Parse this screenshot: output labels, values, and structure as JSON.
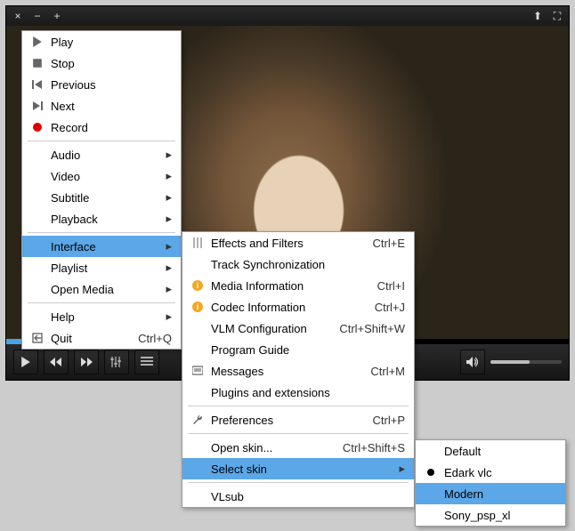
{
  "titlebar": {
    "close": "×",
    "min": "−",
    "plus": "+",
    "up": "⬆",
    "full": "⛶"
  },
  "menu1": {
    "play": "Play",
    "stop": "Stop",
    "previous": "Previous",
    "next": "Next",
    "record": "Record",
    "audio": "Audio",
    "video": "Video",
    "subtitle": "Subtitle",
    "playback": "Playback",
    "interface": "Interface",
    "playlist": "Playlist",
    "open_media": "Open Media",
    "help": "Help",
    "quit": "Quit",
    "quit_sc": "Ctrl+Q"
  },
  "menu2": {
    "effects": "Effects and Filters",
    "effects_sc": "Ctrl+E",
    "track_sync": "Track Synchronization",
    "media_info": "Media Information",
    "media_info_sc": "Ctrl+I",
    "codec_info": "Codec Information",
    "codec_info_sc": "Ctrl+J",
    "vlm": "VLM Configuration",
    "vlm_sc": "Ctrl+Shift+W",
    "program_guide": "Program Guide",
    "messages": "Messages",
    "messages_sc": "Ctrl+M",
    "plugins": "Plugins and extensions",
    "preferences": "Preferences",
    "preferences_sc": "Ctrl+P",
    "open_skin": "Open skin...",
    "open_skin_sc": "Ctrl+Shift+S",
    "select_skin": "Select skin",
    "vlsub": "VLsub"
  },
  "menu3": {
    "default": "Default",
    "edark": "Edark vlc",
    "modern": "Modern",
    "sony": "Sony_psp_xl"
  }
}
